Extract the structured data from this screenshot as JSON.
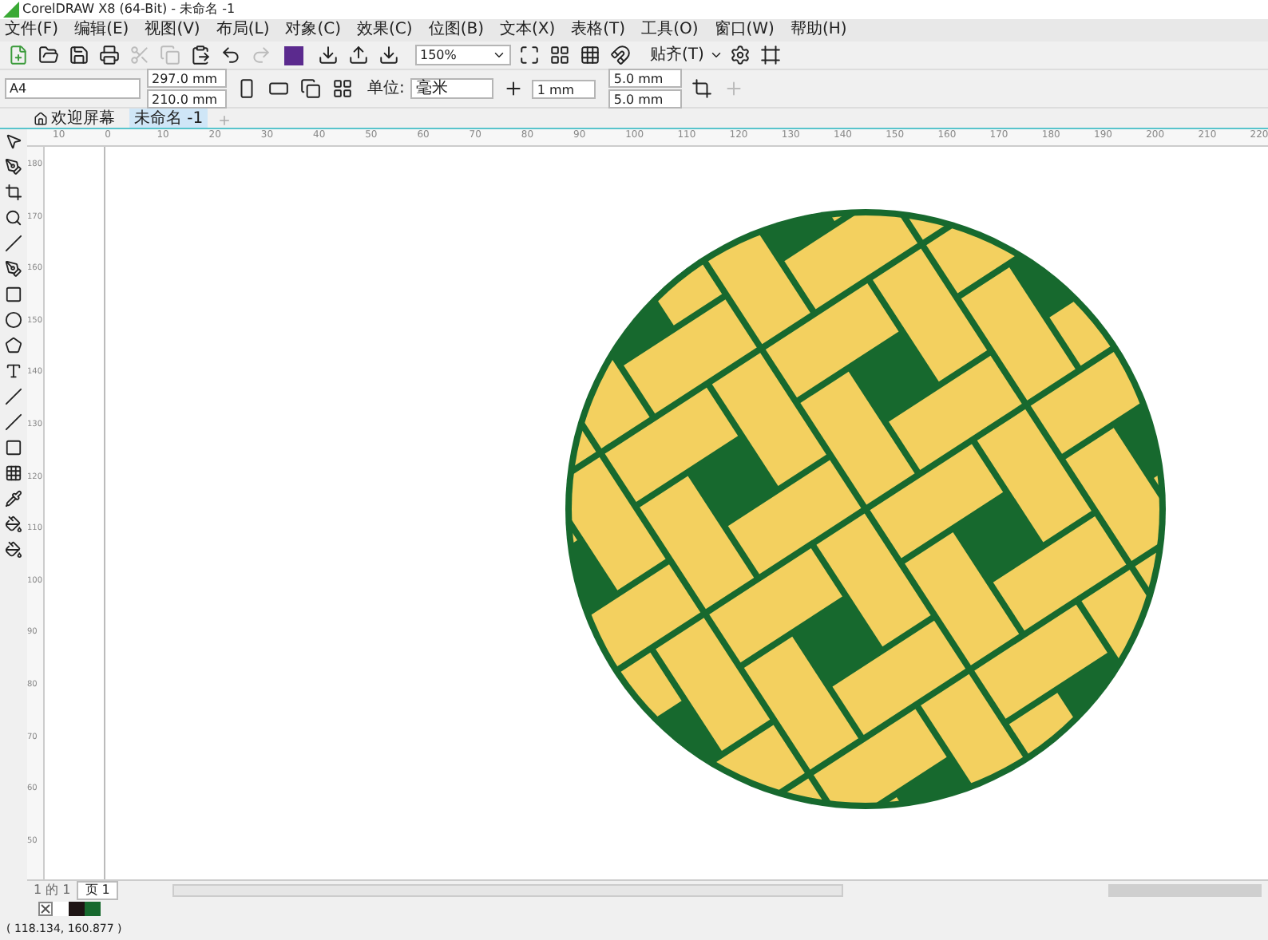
{
  "window": {
    "title": "CorelDRAW X8 (64-Bit) - 未命名 -1"
  },
  "menu": [
    "文件(F)",
    "编辑(E)",
    "视图(V)",
    "布局(L)",
    "对象(C)",
    "效果(C)",
    "位图(B)",
    "文本(X)",
    "表格(T)",
    "工具(O)",
    "窗口(W)",
    "帮助(H)"
  ],
  "toolbar": {
    "zoom": "150%",
    "snap": "贴齐(T)"
  },
  "property_bar": {
    "page_size": "A4",
    "width": "297.0 mm",
    "height": "210.0 mm",
    "units_label": "单位:",
    "units": "毫米",
    "nudge": "1 mm",
    "dup_x": "5.0 mm",
    "dup_y": "5.0 mm"
  },
  "tabs": [
    {
      "label": "欢迎屏幕",
      "selected": false
    },
    {
      "label": "未命名 -1",
      "selected": true
    }
  ],
  "ruler": {
    "horizontal": [
      "10",
      "0",
      "10",
      "20",
      "30",
      "40",
      "50",
      "60",
      "70",
      "80",
      "90",
      "100",
      "110",
      "120",
      "130",
      "140",
      "150",
      "160",
      "170",
      "180",
      "190",
      "200",
      "210",
      "220"
    ],
    "vertical": [
      "180",
      "170",
      "160",
      "150",
      "140",
      "130",
      "120",
      "110",
      "100",
      "90",
      "80",
      "70",
      "60",
      "50"
    ]
  },
  "pager": {
    "position": "1 的 1",
    "page_tab": "页 1"
  },
  "palette": [
    {
      "color": "#ffffff"
    },
    {
      "color": "#1e1414"
    },
    {
      "color": "#17692e"
    }
  ],
  "status_bar": {
    "coordinates": "( 118.134, 160.877 )"
  }
}
